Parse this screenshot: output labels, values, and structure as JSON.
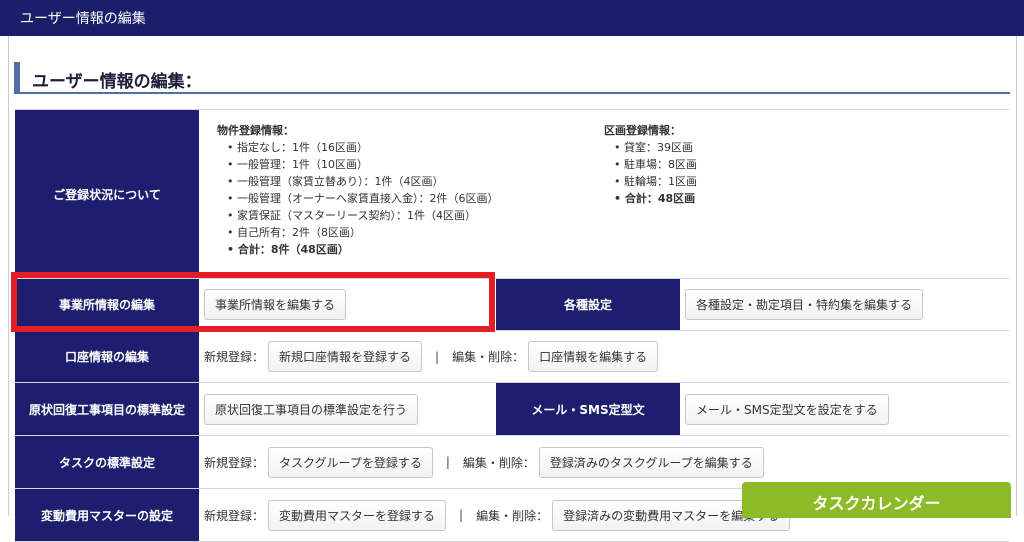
{
  "header": {
    "title": "ユーザー情報の編集"
  },
  "section": {
    "title": "ユーザー情報の編集："
  },
  "registration": {
    "label": "ご登録状況について",
    "property": {
      "title": "物件登録情報：",
      "items": [
        "指定なし：1件（16区画）",
        "一般管理：1件（10区画）",
        "一般管理（家賃立替あり）：1件（4区画）",
        "一般管理（オーナーへ家賃直接入金）：2件（6区画）",
        "家賃保証（マスターリース契約）：1件（4区画）",
        "自己所有：2件（8区画）"
      ],
      "total": "合計：8件（48区画）"
    },
    "section": {
      "title": "区画登録情報：",
      "items": [
        "貸室：39区画",
        "駐車場：8区画",
        "駐輪場：1区画"
      ],
      "total": "合計：48区画"
    }
  },
  "office": {
    "label": "事業所情報の編集",
    "button": "事業所情報を編集する"
  },
  "settings": {
    "label": "各種設定",
    "button": "各種設定・勘定項目・特約集を編集する"
  },
  "account": {
    "label": "口座情報の編集",
    "new_label": "新規登録：",
    "new_button": "新規口座情報を登録する",
    "separator": "|",
    "edit_label": "編集・削除：",
    "edit_button": "口座情報を編集する"
  },
  "restoration": {
    "label": "原状回復工事項目の標準設定",
    "button": "原状回復工事項目の標準設定を行う"
  },
  "mail": {
    "label": "メール・SMS定型文",
    "button": "メール・SMS定型文を設定をする"
  },
  "task": {
    "label": "タスクの標準設定",
    "new_label": "新規登録：",
    "new_button": "タスクグループを登録する",
    "separator": "|",
    "edit_label": "編集・削除：",
    "edit_button": "登録済みのタスクグループを編集する"
  },
  "variable": {
    "label": "変動費用マスターの設定",
    "new_label": "新規登録：",
    "new_button": "変動費用マスターを登録する",
    "separator": "|",
    "edit_label": "編集・削除：",
    "edit_button": "登録済みの変動費用マスターを編集する"
  },
  "task_calendar": {
    "label": "タスクカレンダー"
  },
  "colors": {
    "header_bg": "#1b1f6b",
    "cell_head_bg": "#1d1f6e",
    "highlight": "#e21e26",
    "calendar_bg": "#8dbb28"
  }
}
